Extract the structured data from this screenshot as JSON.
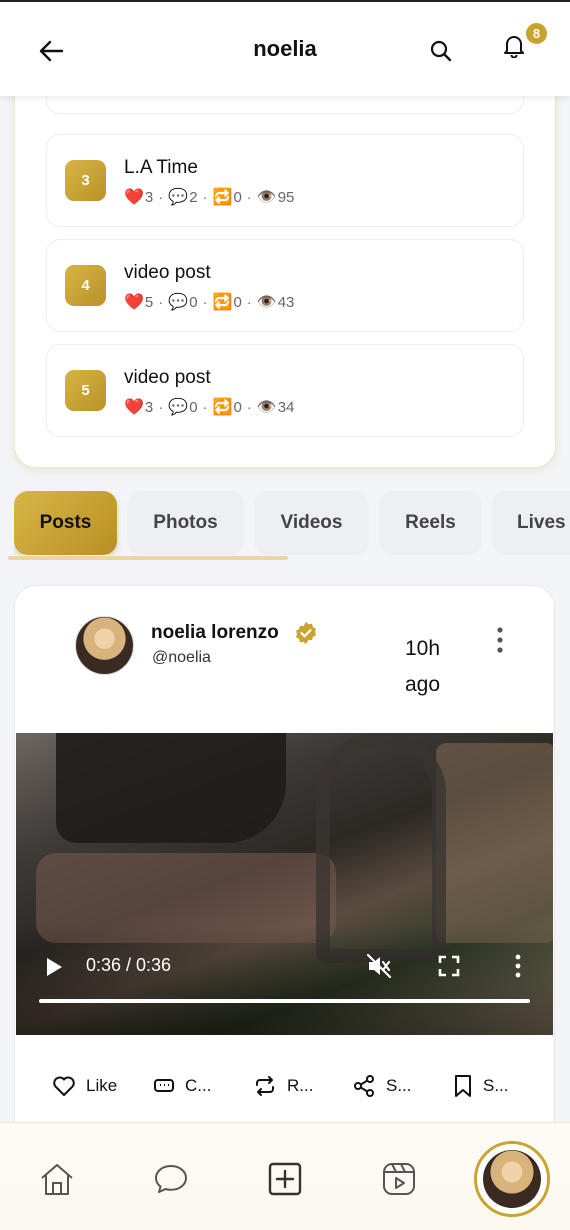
{
  "header": {
    "title": "noelia",
    "notification_count": "8"
  },
  "top_posts": [
    {
      "rank": "3",
      "title": "L.A Time",
      "likes": "3",
      "comments": "2",
      "reposts": "0",
      "views": "95"
    },
    {
      "rank": "4",
      "title": "video post",
      "likes": "5",
      "comments": "0",
      "reposts": "0",
      "views": "43"
    },
    {
      "rank": "5",
      "title": "video post",
      "likes": "3",
      "comments": "0",
      "reposts": "0",
      "views": "34"
    }
  ],
  "stat_icons": {
    "likes": "❤️",
    "comments": "💬",
    "reposts": "🔁",
    "views": "👁️",
    "separator": "·"
  },
  "tabs": [
    {
      "label": "Posts",
      "active": true
    },
    {
      "label": "Photos"
    },
    {
      "label": "Videos"
    },
    {
      "label": "Reels"
    },
    {
      "label": "Lives"
    }
  ],
  "post": {
    "author_name": "noelia lorenzo",
    "handle": "@noelia",
    "time": "10h ago",
    "video": {
      "time_display": "0:36 / 0:36",
      "progress": 1.0,
      "muted": true
    }
  },
  "actions": {
    "like": "Like",
    "comment": "C...",
    "repost": "R...",
    "share": "S...",
    "save": "S..."
  },
  "colors": {
    "accent": "#c7a32e",
    "background": "#f3f4f8"
  }
}
